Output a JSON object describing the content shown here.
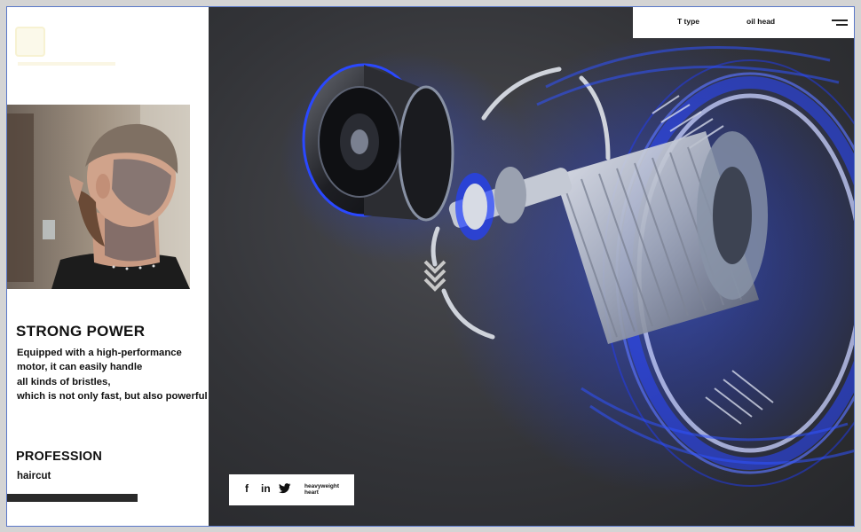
{
  "nav": {
    "items": [
      "T type",
      "oil head"
    ],
    "menu_icon": "hamburger-icon"
  },
  "left": {
    "title": "STRONG POWER",
    "description_lines": [
      "Equipped with a high-performance",
      "motor, it can easily handle",
      "all kinds of bristles,",
      "which is not only fast, but also powerful"
    ],
    "profession_title": "PROFESSION",
    "profession_value": "haircut"
  },
  "social": {
    "icons": [
      "f",
      "in",
      "twitter-icon"
    ],
    "facebook_label": "f",
    "linkedin_label": "in",
    "tagline": "heavyweight heart"
  },
  "colors": {
    "accent_blue": "#2c4bff",
    "hero_bg": "#333438",
    "frame_border": "#5a78c8"
  }
}
